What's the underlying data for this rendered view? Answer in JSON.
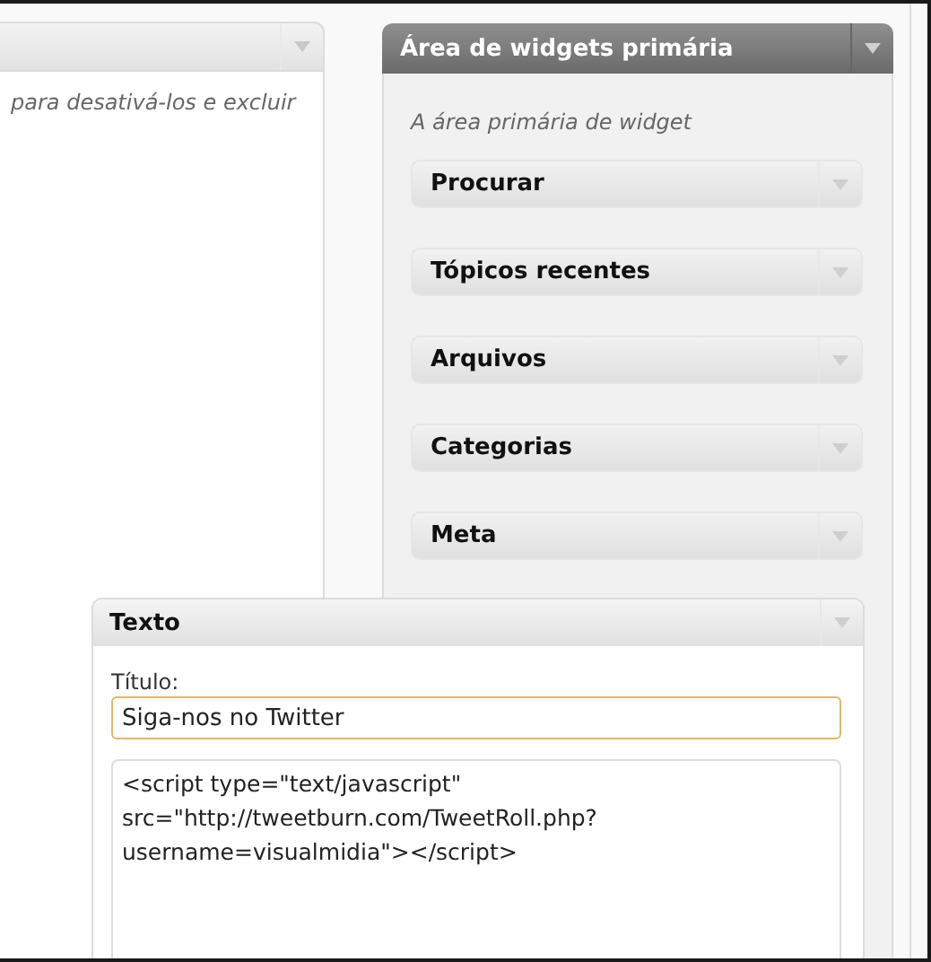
{
  "left_panel": {
    "description": "para desativá-los e excluir"
  },
  "sidebar": {
    "title": "Área de widgets primária",
    "description": "A área primária de widget",
    "widgets": [
      {
        "title": "Procurar"
      },
      {
        "title": "Tópicos recentes"
      },
      {
        "title": "Arquivos"
      },
      {
        "title": "Categorias"
      },
      {
        "title": "Meta"
      }
    ]
  },
  "dragged_widget": {
    "title": "Texto",
    "title_label": "Título:",
    "title_value": "Siga-nos no Twitter",
    "content": "<script type=\"text/javascript\"\nsrc=\"http://tweetburn.com/TweetRoll.php?\nusername=visualmidia\"></script>"
  }
}
